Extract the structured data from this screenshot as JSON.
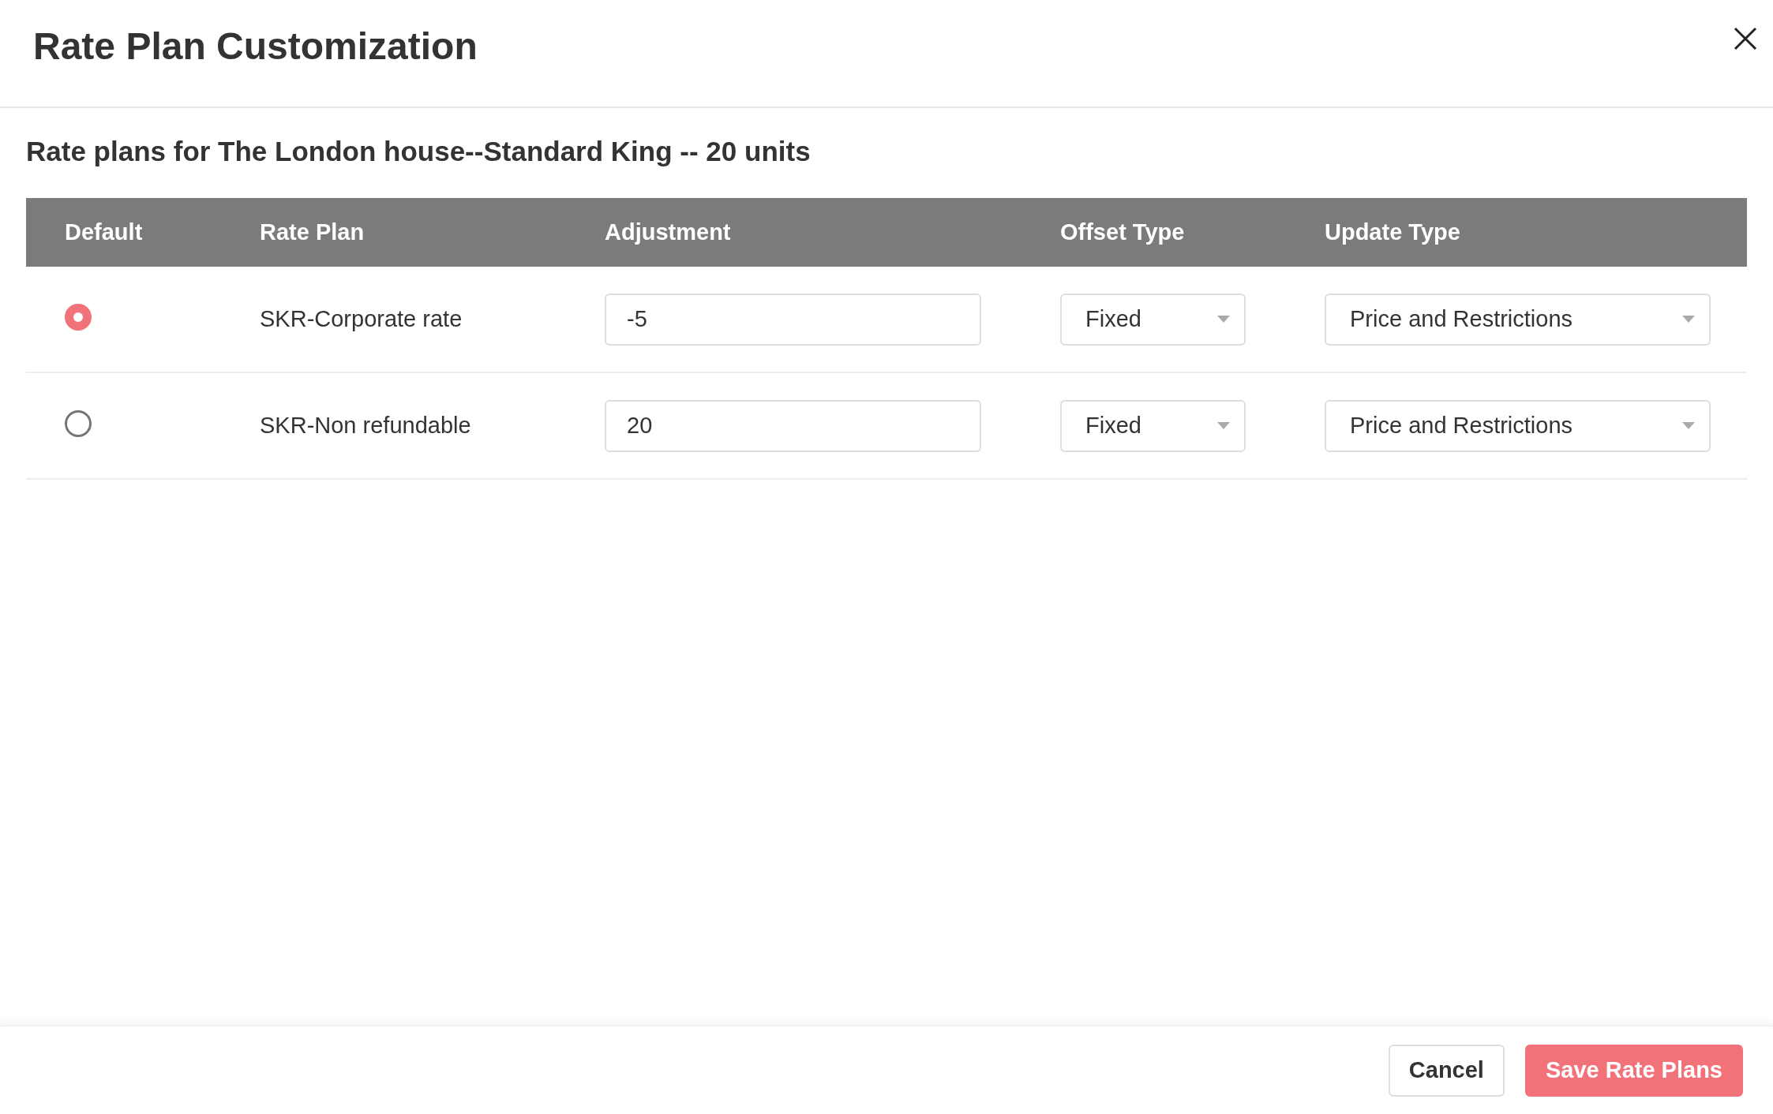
{
  "dialog": {
    "title": "Rate Plan Customization"
  },
  "subtitle": "Rate plans for The London house--Standard King -- 20 units",
  "table": {
    "columns": [
      "Default",
      "Rate Plan",
      "Adjustment",
      "Offset Type",
      "Update Type"
    ],
    "rows": [
      {
        "selected": true,
        "rate_plan": "SKR-Corporate rate",
        "adjustment": "-5",
        "offset_type": "Fixed",
        "update_type": "Price and Restrictions"
      },
      {
        "selected": false,
        "rate_plan": "SKR-Non refundable",
        "adjustment": "20",
        "offset_type": "Fixed",
        "update_type": "Price and Restrictions"
      }
    ]
  },
  "buttons": [
    {
      "label": "Cancel",
      "kind": "secondary"
    },
    {
      "label": "Save Rate Plans",
      "kind": "primary"
    }
  ]
}
